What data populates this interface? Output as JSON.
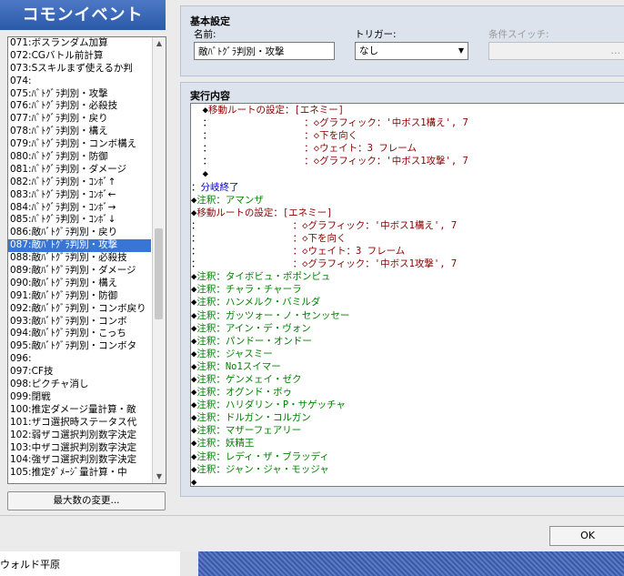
{
  "header": {
    "title": "コモンイベント"
  },
  "event_list": {
    "items": [
      "071:ボスランダム加算",
      "072:CGバトル前計算",
      "073:Sスキルまず使えるか判",
      "074:",
      "075:ﾊﾞﾄｸﾞﾗ判別・攻撃",
      "076:ﾊﾞﾄｸﾞﾗ判別・必殺技",
      "077:ﾊﾞﾄｸﾞﾗ判別・戻り",
      "078:ﾊﾞﾄｸﾞﾗ判別・構え",
      "079:ﾊﾞﾄｸﾞﾗ判別・コンボ構え",
      "080:ﾊﾞﾄｸﾞﾗ判別・防御",
      "081:ﾊﾞﾄｸﾞﾗ判別・ダメージ",
      "082:ﾊﾞﾄｸﾞﾗ判別・ｺﾝﾎﾞ↑",
      "083:ﾊﾞﾄｸﾞﾗ判別・ｺﾝﾎﾞ←",
      "084:ﾊﾞﾄｸﾞﾗ判別・ｺﾝﾎﾞ→",
      "085:ﾊﾞﾄｸﾞﾗ判別・ｺﾝﾎﾞ↓",
      "086:敵ﾊﾞﾄｸﾞﾗ判別・戻り",
      "087:敵ﾊﾞﾄｸﾞﾗ判別・攻撃",
      "088:敵ﾊﾞﾄｸﾞﾗ判別・必殺技",
      "089:敵ﾊﾞﾄｸﾞﾗ判別・ダメージ",
      "090:敵ﾊﾞﾄｸﾞﾗ判別・構え",
      "091:敵ﾊﾞﾄｸﾞﾗ判別・防御",
      "092:敵ﾊﾞﾄｸﾞﾗ判別・コンボ戻り",
      "093:敵ﾊﾞﾄｸﾞﾗ判別・コンボ",
      "094:敵ﾊﾞﾄｸﾞﾗ判別・こっち",
      "095:敵ﾊﾞﾄｸﾞﾗ判別・コンボタ",
      "096:",
      "097:CF技",
      "098:ピクチャ消し",
      "099:閉戦",
      "100:推定ダメージ量計算・敵",
      "101:ザコ選択時ステータス代",
      "102:弱ザコ選択判別数字決定",
      "103:中ザコ選択判別数字決定",
      "104:強ザコ選択判別数字決定",
      "105:推定ﾀﾞﾒｰｼﾞ量計算・中"
    ],
    "selected_index": 16,
    "max_button": "最大数の変更..."
  },
  "basic": {
    "title": "基本設定",
    "name_label": "名前:",
    "name_value": "敵ﾊﾞﾄｸﾞﾗ判別・攻撃",
    "trigger_label": "トリガー:",
    "trigger_value": "なし",
    "switch_label": "条件スイッチ:",
    "switch_button": "..."
  },
  "exec": {
    "title": "実行内容",
    "lines": [
      {
        "indent": "  ",
        "prefix": "◆",
        "text": "移動ルートの設定：[エネミー]",
        "color": "#8b0000"
      },
      {
        "indent": "  ：",
        "prefix": "",
        "text": "                ：◇グラフィック：'中ボス1構え', 7",
        "color": "#8b0000"
      },
      {
        "indent": "  ：",
        "prefix": "",
        "text": "                ：◇下を向く",
        "color": "#8b0000"
      },
      {
        "indent": "  ：",
        "prefix": "",
        "text": "                ：◇ウェイト：3 フレーム",
        "color": "#8b0000"
      },
      {
        "indent": "  ：",
        "prefix": "",
        "text": "                ：◇グラフィック：'中ボス1攻撃', 7",
        "color": "#8b0000"
      },
      {
        "indent": "  ",
        "prefix": "◆",
        "text": "",
        "color": "#000000"
      },
      {
        "indent": "：",
        "prefix": "",
        "text": "分岐終了",
        "color": "#0000cd"
      },
      {
        "indent": "",
        "prefix": "◆",
        "text": "注釈：アマンザ",
        "color": "#008000"
      },
      {
        "indent": "",
        "prefix": "◆",
        "text": "移動ルートの設定：[エネミー]",
        "color": "#8b0000"
      },
      {
        "indent": "：",
        "prefix": "",
        "text": "                ：◇グラフィック：'中ボス1構え', 7",
        "color": "#8b0000"
      },
      {
        "indent": "：",
        "prefix": "",
        "text": "                ：◇下を向く",
        "color": "#8b0000"
      },
      {
        "indent": "：",
        "prefix": "",
        "text": "                ：◇ウェイト：3 フレーム",
        "color": "#8b0000"
      },
      {
        "indent": "：",
        "prefix": "",
        "text": "                ：◇グラフィック：'中ボス1攻撃', 7",
        "color": "#8b0000"
      },
      {
        "indent": "",
        "prefix": "◆",
        "text": "注釈：タイボビュ・ポポンピュ",
        "color": "#008000"
      },
      {
        "indent": "",
        "prefix": "◆",
        "text": "注釈：チャラ・チャーラ",
        "color": "#008000"
      },
      {
        "indent": "",
        "prefix": "◆",
        "text": "注釈：ハンメルク・バミルダ",
        "color": "#008000"
      },
      {
        "indent": "",
        "prefix": "◆",
        "text": "注釈：ガッツォー・ノ・センッセー",
        "color": "#008000"
      },
      {
        "indent": "",
        "prefix": "◆",
        "text": "注釈：アイン・デ・ヴォン",
        "color": "#008000"
      },
      {
        "indent": "",
        "prefix": "◆",
        "text": "注釈：パンドー・オンドー",
        "color": "#008000"
      },
      {
        "indent": "",
        "prefix": "◆",
        "text": "注釈：ジャスミー",
        "color": "#008000"
      },
      {
        "indent": "",
        "prefix": "◆",
        "text": "注釈：No1スイマー",
        "color": "#008000"
      },
      {
        "indent": "",
        "prefix": "◆",
        "text": "注釈：ゲンメェイ・ゼク",
        "color": "#008000"
      },
      {
        "indent": "",
        "prefix": "◆",
        "text": "注釈：オグンド・ボゥ",
        "color": "#008000"
      },
      {
        "indent": "",
        "prefix": "◆",
        "text": "注釈：ハリダリン・P・サゲッチャ",
        "color": "#008000"
      },
      {
        "indent": "",
        "prefix": "◆",
        "text": "注釈：ドルガン・コルガン",
        "color": "#008000"
      },
      {
        "indent": "",
        "prefix": "◆",
        "text": "注釈：マザーフェアリー",
        "color": "#008000"
      },
      {
        "indent": "",
        "prefix": "◆",
        "text": "注釈：妖精王",
        "color": "#008000"
      },
      {
        "indent": "",
        "prefix": "◆",
        "text": "注釈：レディ・ザ・ブラッディ",
        "color": "#008000"
      },
      {
        "indent": "",
        "prefix": "◆",
        "text": "注釈：ジャン・ジャ・モッジャ",
        "color": "#008000"
      },
      {
        "indent": "",
        "prefix": "◆",
        "text": "",
        "color": "#000000"
      }
    ]
  },
  "footer": {
    "ok_label": "OK"
  },
  "map": {
    "name": "ウォルド平原"
  },
  "icons": {
    "scroll_up": "chevron-up-icon",
    "scroll_down": "chevron-down-icon",
    "select_arrow": "triangle-down-icon"
  }
}
